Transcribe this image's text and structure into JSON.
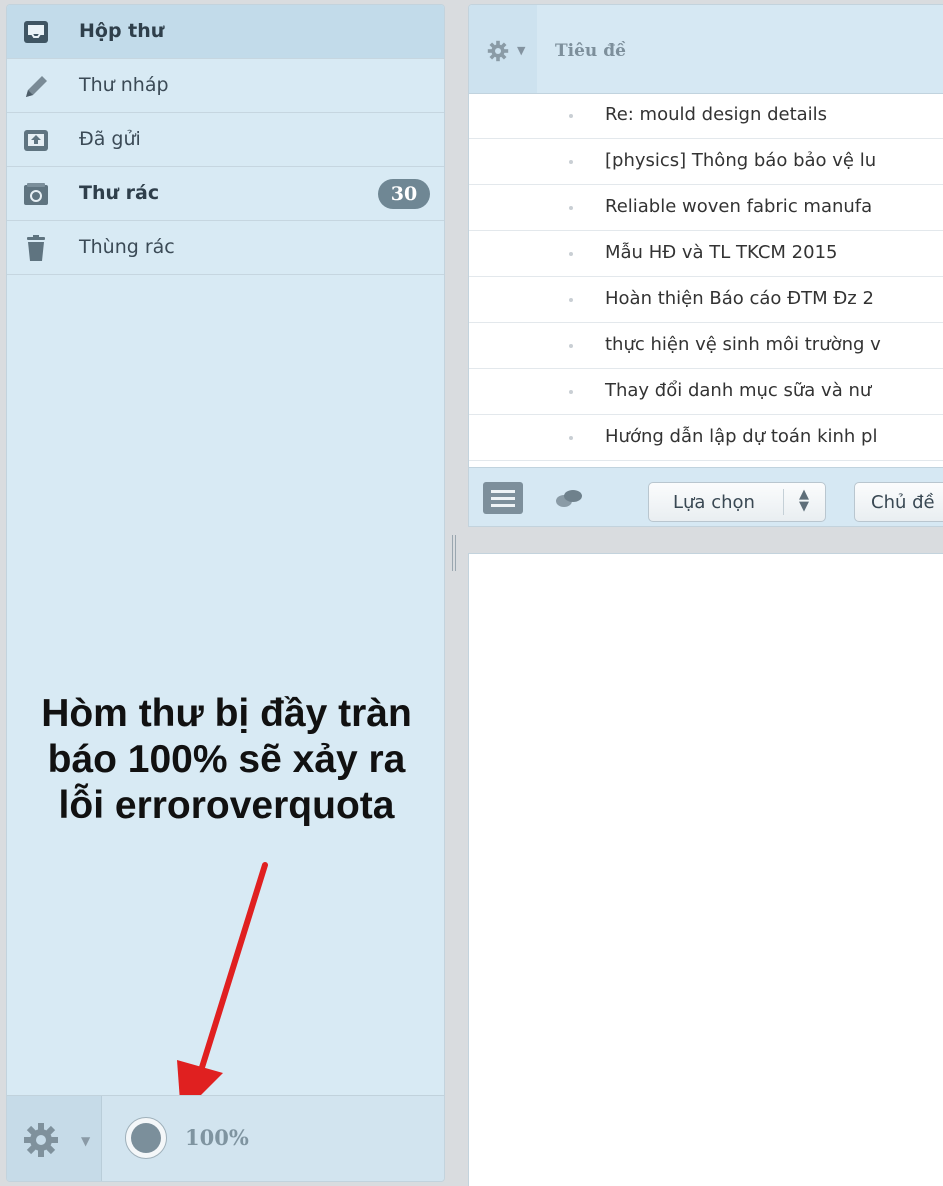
{
  "sidebar": {
    "folders": [
      {
        "label": "Hộp thư",
        "icon": "inbox-icon",
        "selected": true
      },
      {
        "label": "Thư nháp",
        "icon": "pencil-icon"
      },
      {
        "label": "Đã gửi",
        "icon": "sent-icon"
      },
      {
        "label": "Thư rác",
        "icon": "junk-icon",
        "badge": "30"
      },
      {
        "label": "Thùng rác",
        "icon": "trash-icon"
      }
    ],
    "quota": {
      "text": "100%",
      "level_percent": 100
    }
  },
  "annotation": {
    "line1": "Hòm thư bị đầy tràn",
    "line2": "báo 100% sẽ xảy ra",
    "line3": "lỗi erroroverquota",
    "arrow_color": "#e02020"
  },
  "message_list": {
    "column_title": "Tiêu đề",
    "messages": [
      "Re: mould design details",
      "[physics] Thông báo bảo vệ lu",
      "Reliable woven fabric manufa",
      "Mẫu HĐ và TL TKCM 2015",
      "Hoàn thiện Báo cáo ĐTM Đz 2",
      "thực hiện vệ sinh môi trường v",
      "Thay đổi danh mục sữa và nư",
      "Hướng dẫn lập dự toán kinh pl"
    ],
    "footer": {
      "select_label": "Lựa chọn",
      "topic_label": "Chủ đề"
    }
  },
  "colors": {
    "sidebar_bg": "#d8eaf4",
    "selected_bg": "#c2dbea",
    "badge_bg": "#6f8794",
    "accent_gray": "#7d8f9b"
  }
}
